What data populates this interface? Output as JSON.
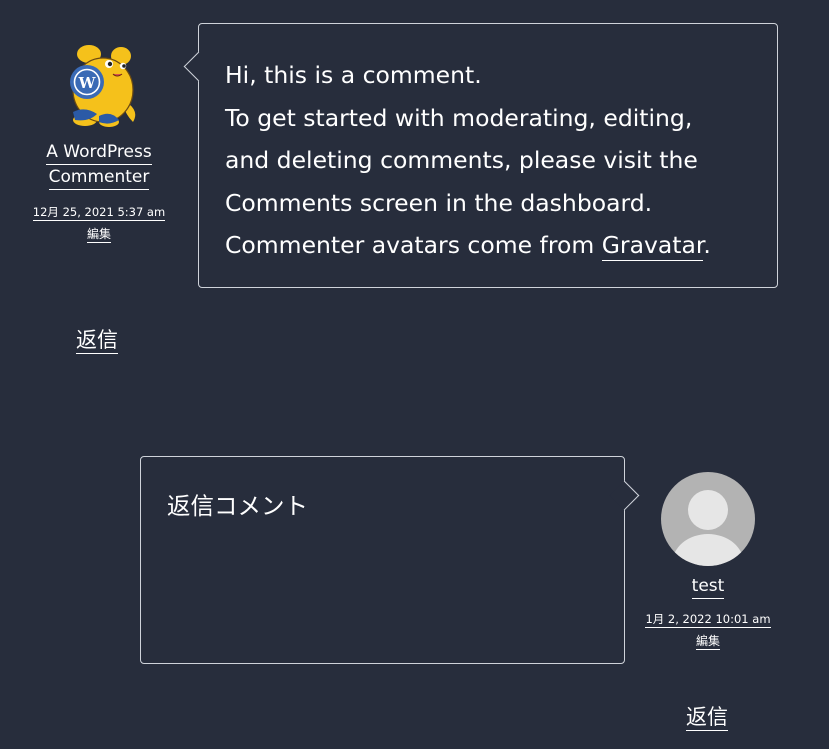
{
  "comments": [
    {
      "author": "A WordPress Commenter",
      "author_line1": "A WordPress",
      "author_line2": "Commenter",
      "avatar": "wapuu-avatar",
      "date": "12月 25, 2021 5:37 am",
      "edit_label": "編集",
      "reply_label": "返信",
      "text_lines": [
        "Hi, this is a comment.",
        "To get started with moderating, editing,",
        "and deleting comments, please visit the",
        "Comments screen in the dashboard."
      ],
      "text_last_prefix": "Commenter avatars come from ",
      "text_last_link": "Gravatar",
      "text_last_suffix": "."
    },
    {
      "author": "test",
      "avatar": "default-person-avatar",
      "date": "1月 2, 2022 10:01 am",
      "edit_label": "編集",
      "reply_label": "返信",
      "text": "返信コメント"
    }
  ],
  "colors": {
    "background": "#272d3c",
    "text": "#ffffff",
    "bubble_border": "#cfd3da",
    "avatar_bg": "#b3b3b3",
    "avatar_fg": "#e6e6e6"
  }
}
